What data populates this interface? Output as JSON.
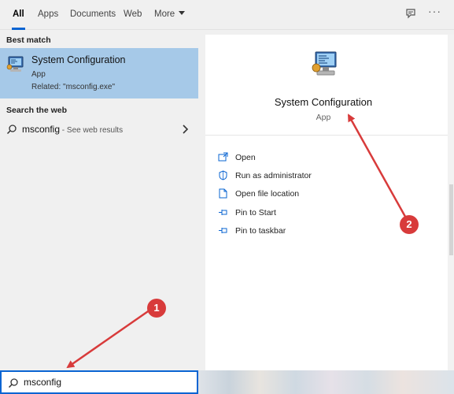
{
  "filter_tabs": [
    {
      "label": "All",
      "active": true
    },
    {
      "label": "Apps",
      "active": false
    },
    {
      "label": "Documents",
      "active": false
    },
    {
      "label": "Web",
      "active": false
    },
    {
      "label": "More",
      "active": false
    }
  ],
  "top_icons": [
    "feedback-icon",
    "more-options-icon"
  ],
  "top_more_glyph": "···",
  "best_match": {
    "heading": "Best match",
    "title": "System Configuration",
    "type": "App",
    "related": "Related: \"msconfig.exe\""
  },
  "web": {
    "heading": "Search the web",
    "term": "msconfig",
    "suffix": " - See web results"
  },
  "detail": {
    "title": "System Configuration",
    "type": "App",
    "actions": [
      {
        "label": "Open",
        "icon": "open-icon"
      },
      {
        "label": "Run as administrator",
        "icon": "shield-icon"
      },
      {
        "label": "Open file location",
        "icon": "file-location-icon"
      },
      {
        "label": "Pin to Start",
        "icon": "pin-icon"
      },
      {
        "label": "Pin to taskbar",
        "icon": "pin-icon"
      }
    ]
  },
  "search": {
    "value": "msconfig",
    "placeholder": ""
  },
  "annotations": [
    {
      "number": "1"
    },
    {
      "number": "2"
    }
  ],
  "colors": {
    "accent": "#0a64d2",
    "selected_row": "#a6c9e8",
    "annotation": "#d83b3b"
  }
}
